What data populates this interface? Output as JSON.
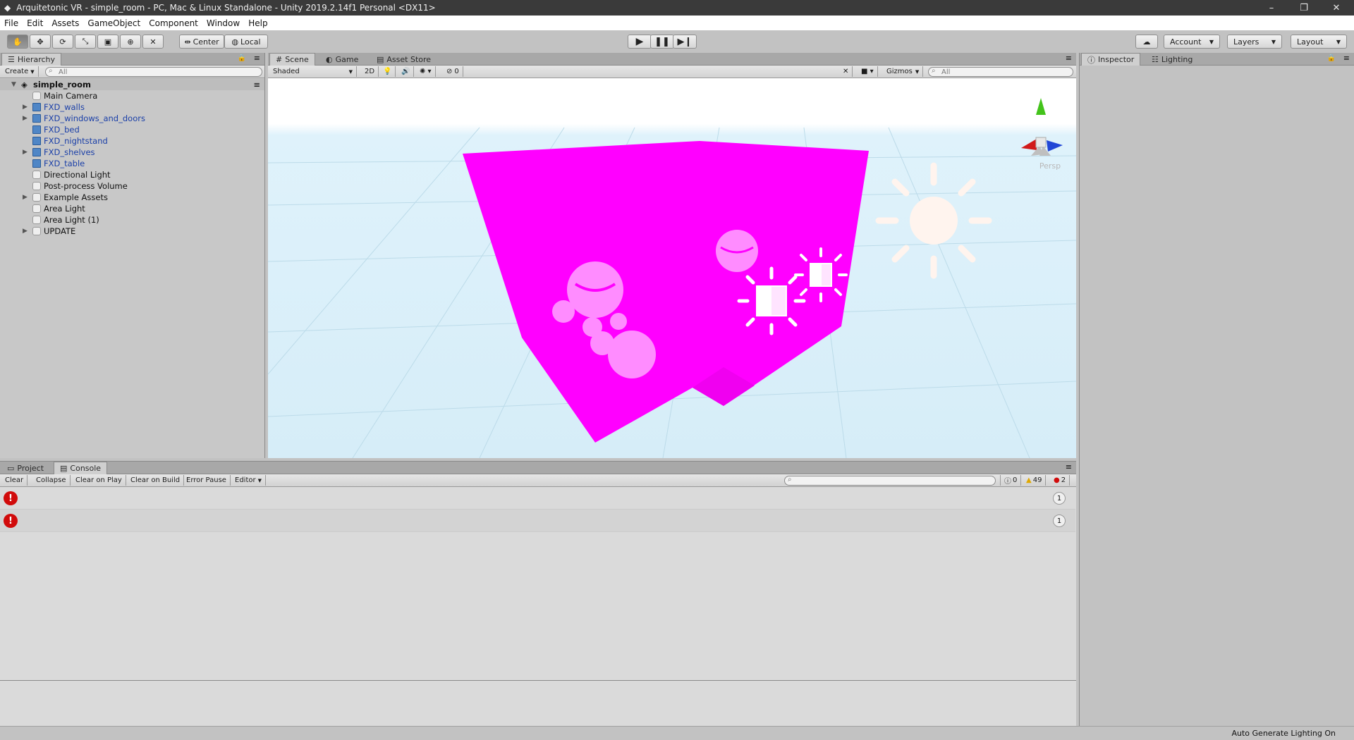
{
  "window": {
    "title": "Arquitetonic VR - simple_room - PC, Mac & Linux Standalone - Unity 2019.2.14f1 Personal <DX11>",
    "minimize": "–",
    "restore": "❐",
    "close": "✕"
  },
  "menu": [
    "File",
    "Edit",
    "Assets",
    "GameObject",
    "Component",
    "Window",
    "Help"
  ],
  "toolbar": {
    "pivot": "Center",
    "space": "Local",
    "account": "Account",
    "layers": "Layers",
    "layout": "Layout"
  },
  "hierarchy": {
    "tab": "Hierarchy",
    "create": "Create",
    "search_placeholder": "All",
    "scene_name": "simple_room",
    "items": [
      {
        "label": "Main Camera",
        "prefab": false,
        "expandable": false
      },
      {
        "label": "FXD_walls",
        "prefab": true,
        "expandable": true
      },
      {
        "label": "FXD_windows_and_doors",
        "prefab": true,
        "expandable": true
      },
      {
        "label": "FXD_bed",
        "prefab": true,
        "expandable": false
      },
      {
        "label": "FXD_nightstand",
        "prefab": true,
        "expandable": false
      },
      {
        "label": "FXD_shelves",
        "prefab": true,
        "expandable": true
      },
      {
        "label": "FXD_table",
        "prefab": true,
        "expandable": false
      },
      {
        "label": "Directional Light",
        "prefab": false,
        "expandable": false
      },
      {
        "label": "Post-process Volume",
        "prefab": false,
        "expandable": false
      },
      {
        "label": "Example Assets",
        "prefab": false,
        "expandable": true
      },
      {
        "label": "Area Light",
        "prefab": false,
        "expandable": false
      },
      {
        "label": "Area Light (1)",
        "prefab": false,
        "expandable": false
      },
      {
        "label": "UPDATE",
        "prefab": false,
        "expandable": true
      }
    ]
  },
  "scene": {
    "tabs": [
      "Scene",
      "Game",
      "Asset Store"
    ],
    "draw_mode": "Shaded",
    "mode_2d": "2D",
    "fx_count": "0",
    "gizmos": "Gizmos",
    "search_placeholder": "All",
    "persp": "Persp",
    "colors": {
      "sky": "#ffffff",
      "ground": "#d9eef9",
      "missing_material": "#ff00ff"
    }
  },
  "right_panel": {
    "tabs": [
      "Inspector",
      "Lighting"
    ]
  },
  "bottom": {
    "tabs": [
      "Project",
      "Console"
    ],
    "buttons": [
      "Clear",
      "Collapse",
      "Clear on Play",
      "Clear on Build",
      "Error Pause",
      "Editor"
    ],
    "info_count": "0",
    "warning_count": "49",
    "error_count": "2",
    "rows": [
      {
        "count": "1"
      },
      {
        "count": "1"
      }
    ]
  },
  "status": {
    "text": "Auto Generate Lighting On"
  }
}
